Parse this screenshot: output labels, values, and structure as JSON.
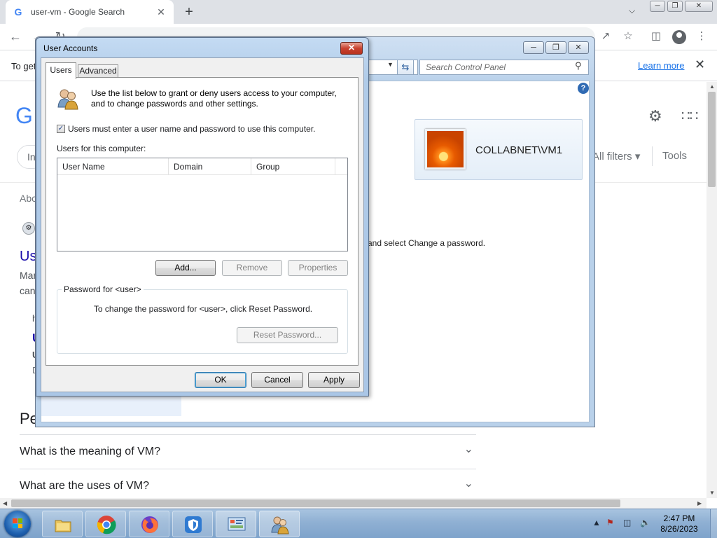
{
  "browser": {
    "tab_title": "user-vm - Google Search",
    "tab_favicon": "G",
    "new_tab": "+",
    "tab_close": "✕"
  },
  "infobar": {
    "text": "To get",
    "learn_more": "Learn more",
    "close": "✕"
  },
  "google": {
    "logo_fragment": "G",
    "chip_fragment": "In",
    "about": "Abo",
    "result_title": "Us",
    "line1": "Mar",
    "line2": "can",
    "h": "h",
    "sub": "U",
    "sub2": "U",
    "grey": "D",
    "people_heading": "Pe",
    "all_filters": "All filters",
    "tools": "Tools",
    "faqs": [
      "What is the meaning of VM?",
      "What are the uses of VM?"
    ]
  },
  "control_panel": {
    "search_placeholder": "Search Control Panel",
    "help": "?",
    "user_name": "COLLABNET\\VM1",
    "password_hint": "and select Change a password."
  },
  "dialog": {
    "title": "User Accounts",
    "tabs": {
      "users": "Users",
      "advanced": "Advanced"
    },
    "intro": "Use the list below to grant or deny users access to your computer, and to change passwords and other settings.",
    "checkbox_label": "Users must enter a user name and password to use this computer.",
    "checkbox_checked": true,
    "list_label": "Users for this computer:",
    "columns": [
      "User Name",
      "Domain",
      "Group"
    ],
    "rows": [],
    "buttons": {
      "add": "Add...",
      "remove": "Remove",
      "properties": "Properties",
      "reset_password": "Reset Password...",
      "ok": "OK",
      "cancel": "Cancel",
      "apply": "Apply"
    },
    "password_group": {
      "legend": "Password for <user>",
      "text": "To change the password for <user>, click Reset Password."
    }
  },
  "taskbar": {
    "apps": [
      "windows-explorer",
      "google-chrome",
      "firefox",
      "security-shield",
      "control-panel",
      "user-accounts"
    ],
    "clock_time": "2:47 PM",
    "clock_date": "8/26/2023"
  }
}
